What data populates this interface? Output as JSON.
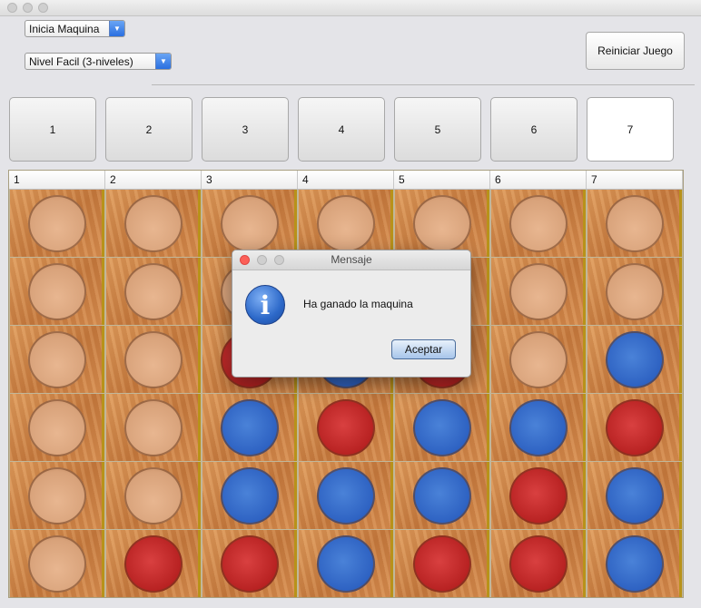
{
  "window": {
    "title": ""
  },
  "controls": {
    "start_combo": {
      "value": "Inicia Maquina"
    },
    "level_combo": {
      "value": "Nivel Facil (3-niveles)"
    },
    "restart_button": "Reiniciar Juego"
  },
  "column_buttons": [
    "1",
    "2",
    "3",
    "4",
    "5",
    "6",
    "7"
  ],
  "selected_column_button": 7,
  "board": {
    "headers": [
      "1",
      "2",
      "3",
      "4",
      "5",
      "6",
      "7"
    ],
    "cells": [
      [
        "empty",
        "empty",
        "empty",
        "empty",
        "empty",
        "empty",
        "empty"
      ],
      [
        "empty",
        "empty",
        "empty",
        "empty",
        "empty",
        "empty",
        "empty"
      ],
      [
        "empty",
        "empty",
        "red",
        "blue",
        "red",
        "empty",
        "blue"
      ],
      [
        "empty",
        "empty",
        "blue",
        "red",
        "blue",
        "blue",
        "red"
      ],
      [
        "empty",
        "empty",
        "blue",
        "blue",
        "blue",
        "red",
        "blue"
      ],
      [
        "empty",
        "red",
        "red",
        "blue",
        "red",
        "red",
        "blue"
      ]
    ],
    "colors": {
      "red": "#c02828",
      "blue": "#2e62c2",
      "empty": "#d8a27a"
    }
  },
  "dialog": {
    "title": "Mensaje",
    "icon": "info-icon",
    "message": "Ha ganado la maquina",
    "button": "Aceptar"
  }
}
